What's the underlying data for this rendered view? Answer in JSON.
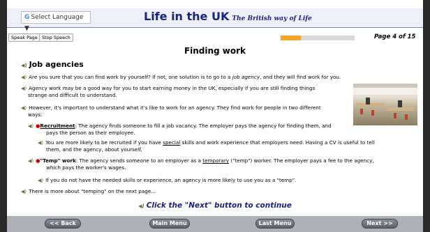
{
  "header": {
    "language": "Select Language",
    "title": "Life in the UK",
    "tagline": "The British way of Life"
  },
  "toolbar": {
    "speak": "Speak Page",
    "stop": "Stop Speech",
    "progress_fraction": 0.27,
    "page_label": "Page 4 of 15"
  },
  "content": {
    "title": "Finding work",
    "section": "Job agencies",
    "p1a": "Are you sure that you can find work by yourself? If not, one solution is to go to a ",
    "p1b": "job agency",
    "p1c": ", and they will find work for you.",
    "p2a": "Agency work may be a good way for you to start earning money in the UK, especially if you are still finding things",
    "p2b": "strange and difficult to understand.",
    "p3a": "However, it's important to understand what it's like to work for an agency. They find work for people in two different",
    "p3b": "ways:",
    "rec_term": "Recruitment",
    "rec_a": ": The agency finds someone to fill a job vacancy. The employer pays the agency for finding them, and",
    "rec_b": "pays the person as their employee.",
    "rec_note_a": "You are more likely to be recruited if you have ",
    "rec_note_u": "special",
    "rec_note_b": " skills and work experience that employers need. Having a CV is useful to tell",
    "rec_note_c": "them, and the agency, about yourself.",
    "temp_term": "\"Temp\" work",
    "temp_a": ": The agency sends someone to an employer as a ",
    "temp_u": "temporary",
    "temp_b": " (\"temp\") worker. The employer pays a fee to the agency,",
    "temp_c": "which pays the worker's wages.",
    "temp_note": "If you do not have the needed skills or experience, an agency is more likely to use you as a \"temp\".",
    "more": "There is more about \"temping\" on the next page...",
    "next_hint": "Click the \"Next\" button to continue"
  },
  "nav": {
    "back": "<< Back",
    "main": "Main Menu",
    "last": "Last Menu",
    "next": "Next >>"
  },
  "icons": {
    "speaker": "speaker-icon",
    "google": "google-icon",
    "dropdown": "dropdown-arrow-icon"
  },
  "colors": {
    "title": "#1a237e",
    "progress": "#f5a623",
    "bullet": "#cc0000"
  }
}
